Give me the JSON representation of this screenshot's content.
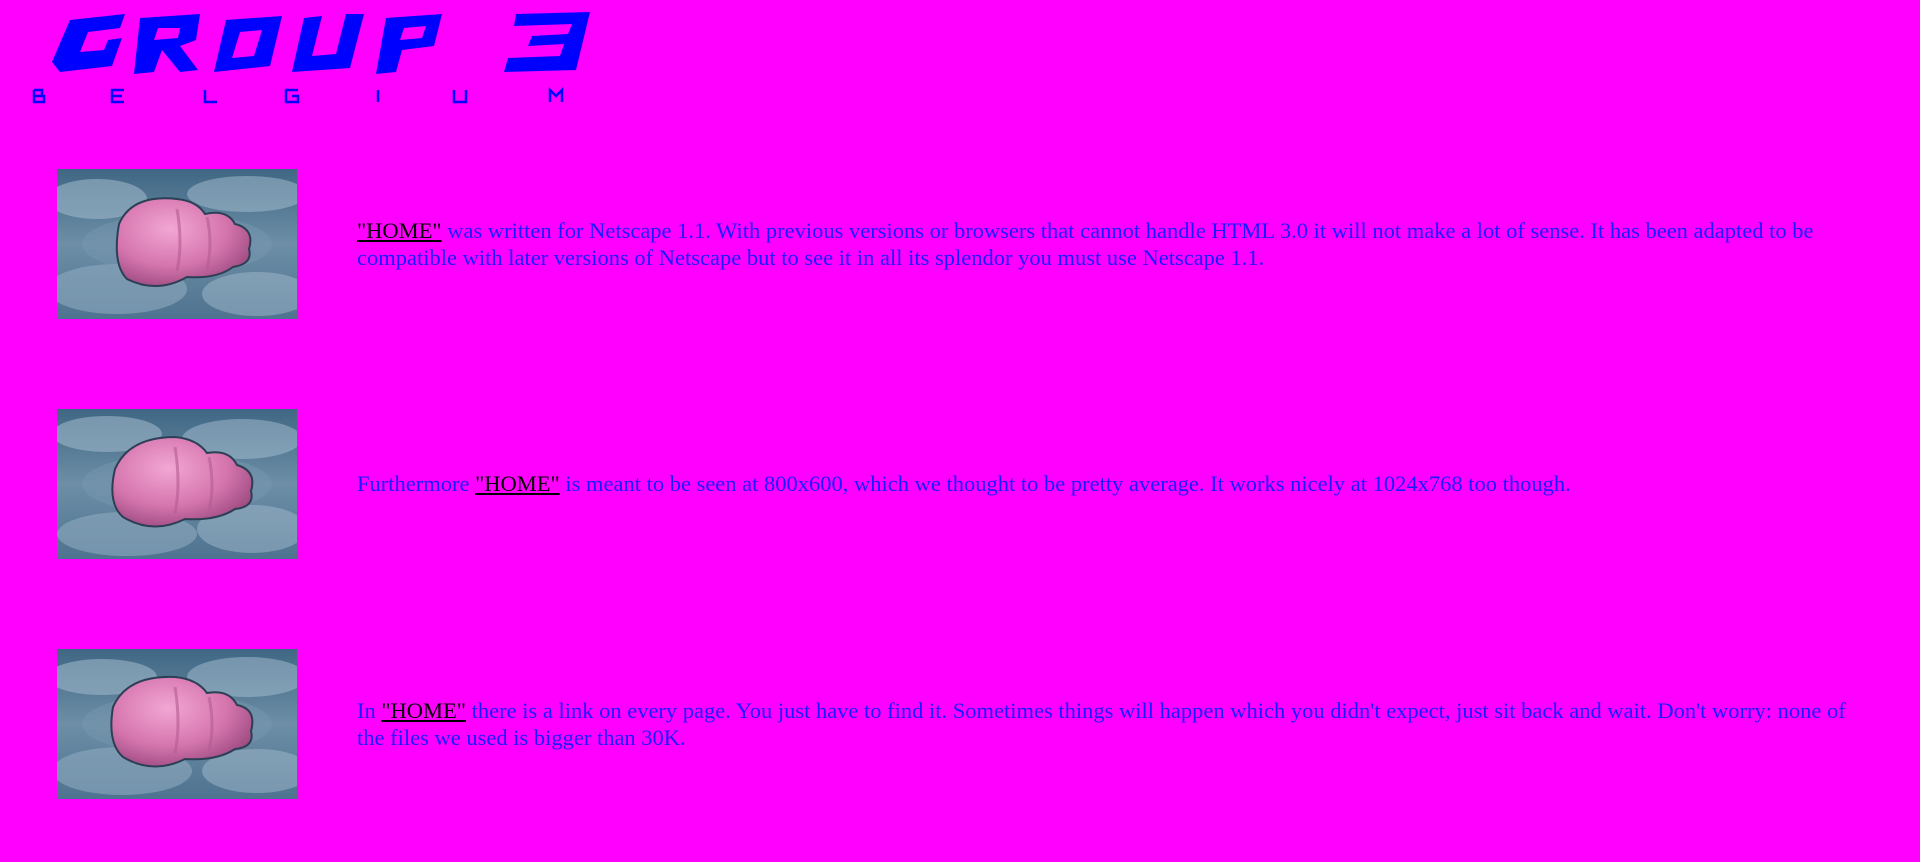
{
  "logo": {
    "wordmark": "GROUP 3",
    "country_letters": [
      "B",
      "E",
      "L",
      "G",
      "I",
      "U",
      "M"
    ]
  },
  "colors": {
    "background": "#ff00ff",
    "text": "#1a1aff",
    "link": "#000000",
    "logo": "#0000ff"
  },
  "paragraphs": [
    {
      "before": "",
      "link": "\"HOME\"",
      "after": " was written for Netscape 1.1. With previous versions or browsers that cannot handle HTML 3.0 it will not make a lot of sense. It has been adapted to be compatible with later versions of Netscape but to see it in all its splendor you must use Netscape 1.1."
    },
    {
      "before": "Furthermore ",
      "link": "\"HOME\"",
      "after": " is meant to be seen at 800x600, which we thought to be pretty average. It works nicely at 1024x768 too though."
    },
    {
      "before": "In ",
      "link": "\"HOME\"",
      "after": " there is a link on every page. You just have to find it. Sometimes things will happen which you didn't expect, just sit back and wait. Don't worry: none of the files we used is bigger than 30K."
    }
  ]
}
